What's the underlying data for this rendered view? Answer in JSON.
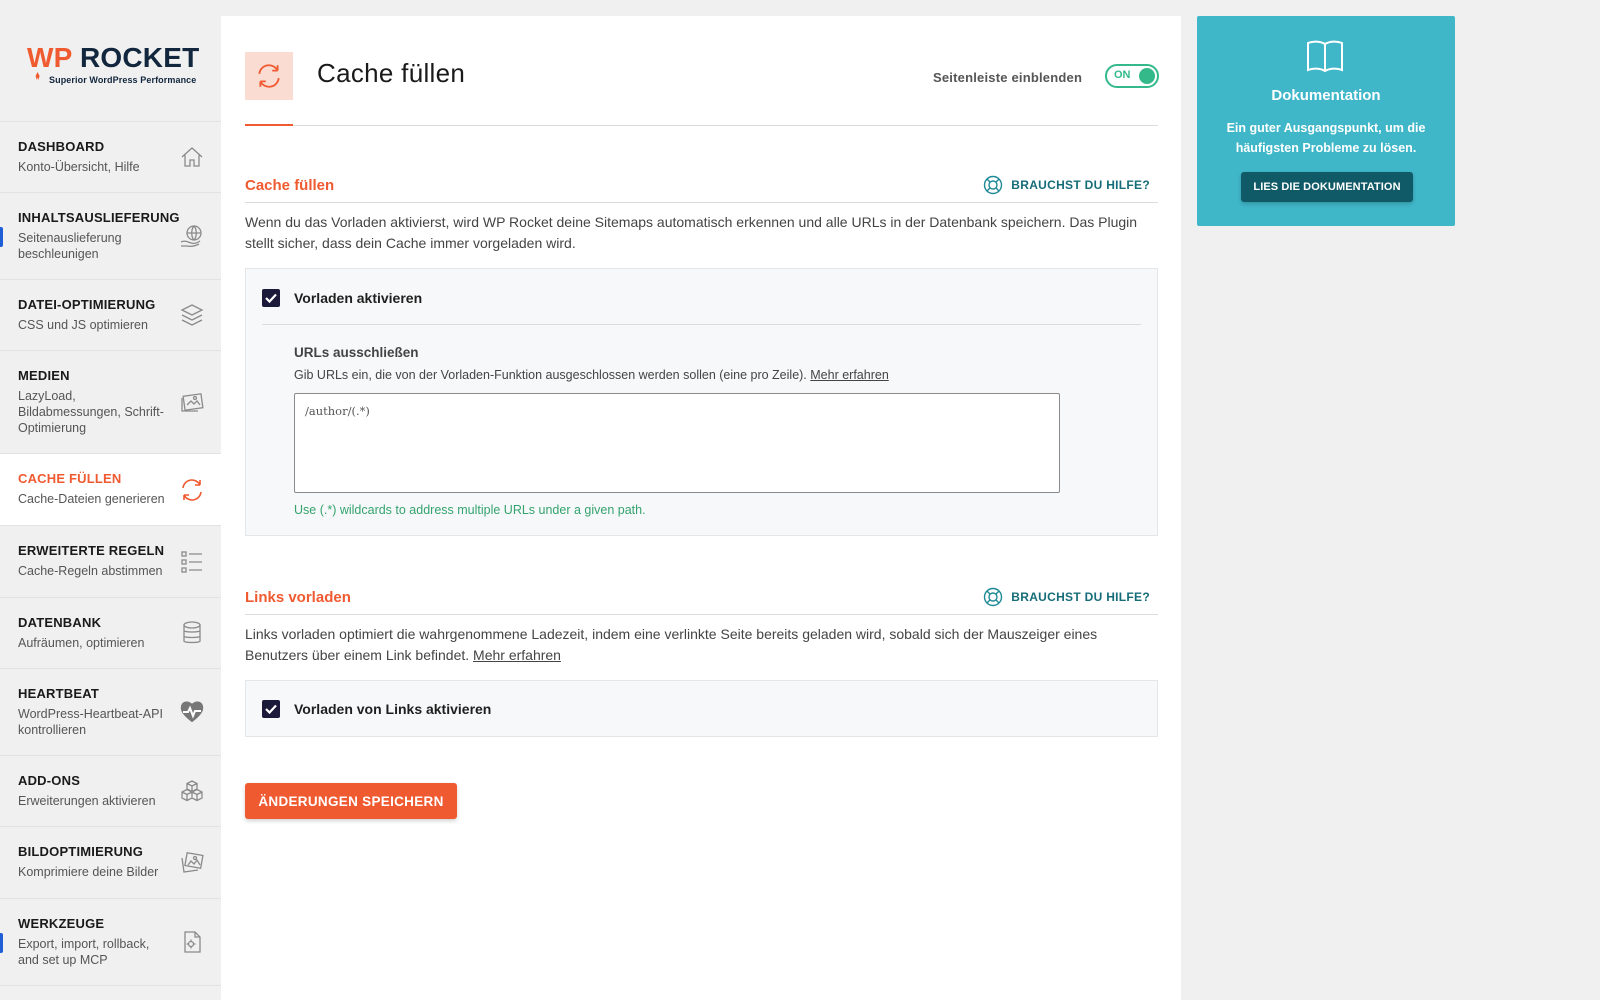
{
  "logo": {
    "wp": "WP",
    "rocket": "ROCKET",
    "tagline": "Superior WordPress Performance"
  },
  "sidebar": {
    "items": [
      {
        "title": "DASHBOARD",
        "sub": "Konto-Übersicht, Hilfe",
        "icon": "home-icon"
      },
      {
        "title": "INHALTSAUSLIEFERUNG",
        "sub": "Seitenauslieferung beschleunigen",
        "icon": "globe-hand-icon"
      },
      {
        "title": "DATEI-OPTIMIERUNG",
        "sub": "CSS und JS optimieren",
        "icon": "layers-icon"
      },
      {
        "title": "MEDIEN",
        "sub": "LazyLoad, Bildabmessungen, Schrift-Optimierung",
        "icon": "images-icon"
      },
      {
        "title": "CACHE FÜLLEN",
        "sub": "Cache-Dateien generieren",
        "icon": "refresh-icon",
        "active": true
      },
      {
        "title": "ERWEITERTE REGELN",
        "sub": "Cache-Regeln abstimmen",
        "icon": "list-icon"
      },
      {
        "title": "DATENBANK",
        "sub": "Aufräumen, optimieren",
        "icon": "database-icon"
      },
      {
        "title": "HEARTBEAT",
        "sub": "WordPress-Heartbeat-API kontrollieren",
        "icon": "heartbeat-icon"
      },
      {
        "title": "ADD-ONS",
        "sub": "Erweiterungen aktivieren",
        "icon": "cubes-icon"
      },
      {
        "title": "BILDOPTIMIERUNG",
        "sub": "Komprimiere deine Bilder",
        "icon": "image-compress-icon"
      },
      {
        "title": "WERKZEUGE",
        "sub": "Export, import, rollback, and set up MCP",
        "icon": "tools-file-icon"
      }
    ]
  },
  "header": {
    "title": "Cache füllen",
    "sidebar_toggle_label": "Seitenleiste einblenden",
    "toggle_state": "ON"
  },
  "section_preload": {
    "title": "Cache füllen",
    "help": "BRAUCHST DU HILFE?",
    "description": "Wenn du das Vorladen aktivierst, wird WP Rocket deine Sitemaps automatisch erkennen und alle URLs in der Datenbank speichern. Das Plugin stellt sicher, dass dein Cache immer vorgeladen wird.",
    "checkbox_label": "Vorladen aktivieren",
    "checked": true,
    "exclude_title": "URLs ausschließen",
    "exclude_desc": "Gib URLs ein, die von der Vorladen-Funktion ausgeschlossen werden sollen (eine pro Zeile).",
    "exclude_link": "Mehr erfahren",
    "exclude_value": "/author/(.*)",
    "hint": "Use (.*) wildcards to address multiple URLs under a given path."
  },
  "section_links": {
    "title": "Links vorladen",
    "help": "BRAUCHST DU HILFE?",
    "description": "Links vorladen optimiert die wahrgenommene Ladezeit, indem eine verlinkte Seite bereits geladen wird, sobald sich der Mauszeiger eines Benutzers über einem Link befindet.",
    "link": "Mehr erfahren",
    "checkbox_label": "Vorladen von Links aktivieren",
    "checked": true
  },
  "save_button": "ÄNDERUNGEN SPEICHERN",
  "doc_card": {
    "title": "Dokumentation",
    "text": "Ein guter Ausgangspunkt, um die häufigsten Probleme zu lösen.",
    "button": "LIES DIE DOKUMENTATION"
  },
  "colors": {
    "accent": "#f05a30",
    "success": "#34b98a",
    "doc_bg": "#40b7c9",
    "doc_btn": "#0f5a66",
    "checkbox": "#1b1a3a"
  }
}
